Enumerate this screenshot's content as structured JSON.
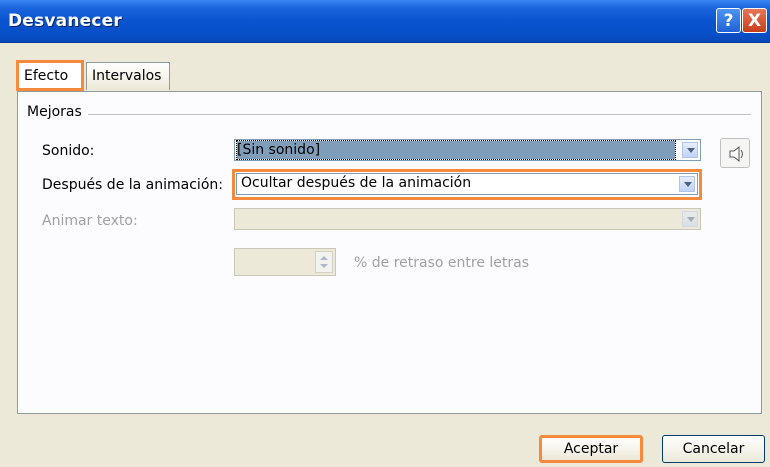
{
  "window": {
    "title": "Desvanecer",
    "help_button": "?",
    "close_button": "X"
  },
  "tabs": [
    {
      "label": "Efecto",
      "active": true
    },
    {
      "label": "Intervalos",
      "active": false
    }
  ],
  "group": {
    "label": "Mejoras"
  },
  "fields": {
    "sound": {
      "label": "Sonido:",
      "value": "[Sin sonido]"
    },
    "after_animation": {
      "label": "Después de la animación:",
      "value": "Ocultar después de la animación"
    },
    "animate_text": {
      "label": "Animar texto:",
      "value": "",
      "disabled": true
    },
    "delay": {
      "value": "",
      "suffix": "% de retraso entre letras",
      "disabled": true
    }
  },
  "buttons": {
    "ok": "Aceptar",
    "cancel": "Cancelar"
  },
  "highlight_color": "#f58a3c",
  "icons": [
    "speaker-icon",
    "dropdown-arrow-icon",
    "spin-arrows-icon",
    "help-icon",
    "close-icon"
  ]
}
